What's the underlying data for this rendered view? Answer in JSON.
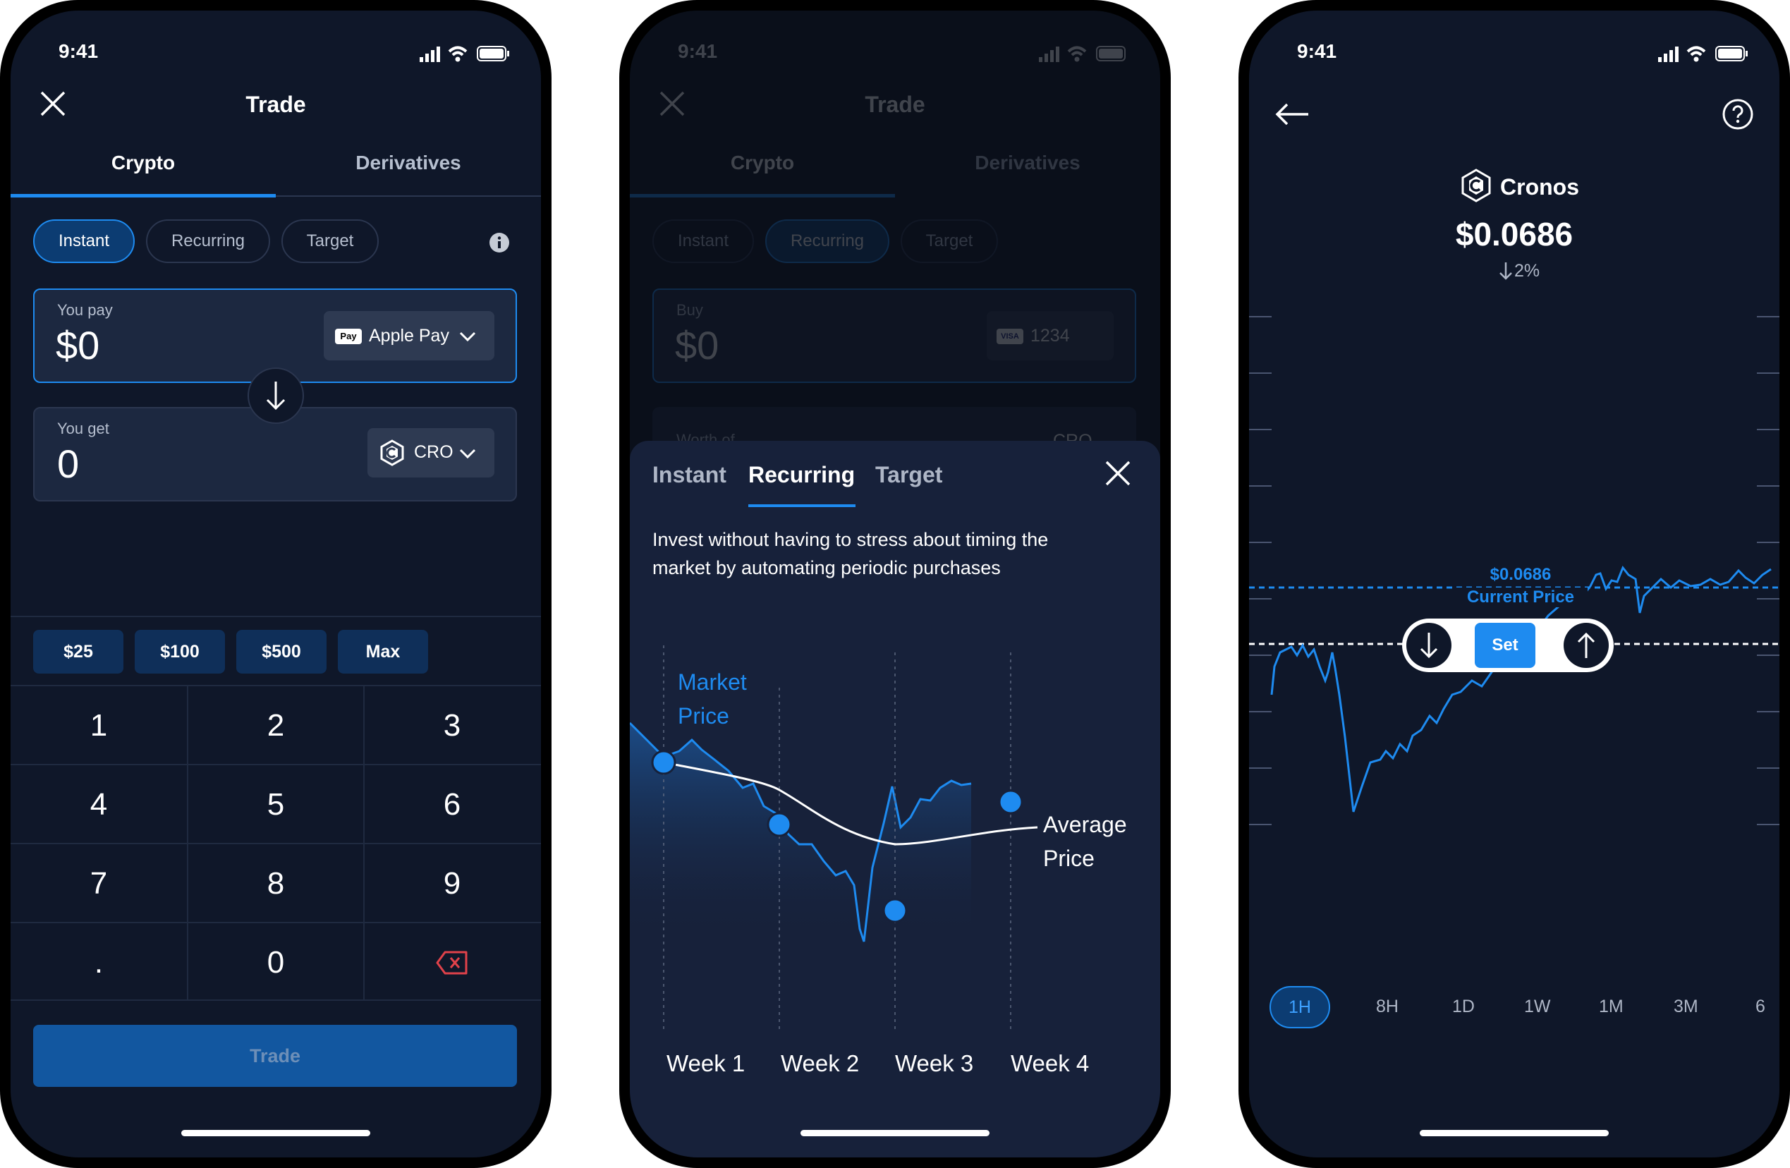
{
  "status": {
    "time": "9:41"
  },
  "phone1": {
    "title": "Trade",
    "tabs": [
      "Crypto",
      "Derivatives"
    ],
    "modes": [
      "Instant",
      "Recurring",
      "Target"
    ],
    "pay": {
      "label": "You pay",
      "amount": "$0",
      "method": "Apple Pay",
      "method_badge": "Pay"
    },
    "get": {
      "label": "You get",
      "amount": "0",
      "asset": "CRO"
    },
    "quick": [
      "$25",
      "$100",
      "$500",
      "Max"
    ],
    "keys": [
      "1",
      "2",
      "3",
      "4",
      "5",
      "6",
      "7",
      "8",
      "9",
      ".",
      "0"
    ],
    "trade_button": "Trade"
  },
  "phone2": {
    "bg_title": "Trade",
    "bg_tabs": [
      "Crypto",
      "Derivatives"
    ],
    "bg_modes": [
      "Instant",
      "Recurring",
      "Target"
    ],
    "bg_buy_label": "Buy",
    "bg_amount": "$0",
    "bg_card": "1234",
    "bg_card_badge": "VISA",
    "bg_worth": "Worth of",
    "bg_asset": "CRO",
    "sheet": {
      "tabs": [
        "Instant",
        "Recurring",
        "Target"
      ],
      "description_line1": "Invest without having to stress about timing the",
      "description_line2": "market by automating periodic purchases",
      "market_price_line1": "Market",
      "market_price_line2": "Price",
      "average_price_line1": "Average",
      "average_price_line2": "Price",
      "weeks": [
        "Week 1",
        "Week 2",
        "Week 3",
        "Week 4"
      ]
    }
  },
  "phone3": {
    "coin_name": "Cronos",
    "price": "$0.0686",
    "change": "2%",
    "current_price_value": "$0.0686",
    "current_price_label": "Current Price",
    "set_button": "Set",
    "timeframes": [
      "1H",
      "8H",
      "1D",
      "1W",
      "1M",
      "3M",
      "6"
    ]
  },
  "colors": {
    "background": "#0f1729",
    "accent": "#1e8bf0",
    "panel": "#1c2840",
    "delete": "#e0424a"
  }
}
